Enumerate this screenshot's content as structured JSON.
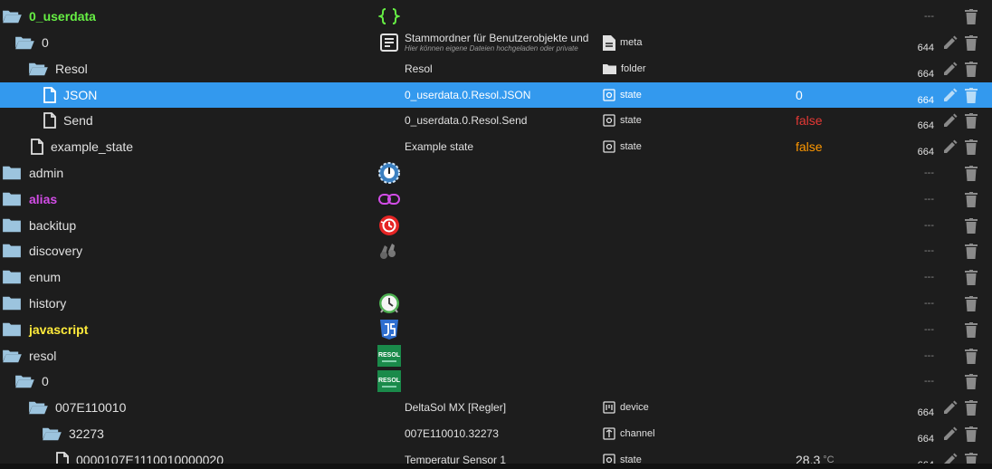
{
  "colors": {
    "accent_selected": "#3399ee",
    "folder_icon": "#9cc4de",
    "value_false_red": "#e53935",
    "value_false_orange": "#ff9800",
    "name_green": "#66ee44",
    "name_magenta": "#d24de6",
    "name_yellow": "#ffeb3b"
  },
  "rows": [
    {
      "name": "0_userdata",
      "icon": "curly-braces-icon",
      "description": "",
      "description_sub": "",
      "type": "",
      "type_icon": "",
      "value": "",
      "unit": "",
      "acl": "---",
      "edit": false
    },
    {
      "name": "0",
      "icon": "note-document-icon",
      "description": "Stammordner für Benutzerobjekte und",
      "description_sub": "Hier können eigene Dateien hochgeladen oder private",
      "type": "meta",
      "type_icon": "meta-file-icon",
      "value": "",
      "unit": "",
      "acl": "644",
      "edit": true
    },
    {
      "name": "Resol",
      "icon": "",
      "description": "Resol",
      "description_sub": "",
      "type": "folder",
      "type_icon": "folder-type-icon",
      "value": "",
      "unit": "",
      "acl": "664",
      "edit": true
    },
    {
      "name": "JSON",
      "icon": "",
      "description": "0_userdata.0.Resol.JSON",
      "description_sub": "",
      "type": "state",
      "type_icon": "state-type-icon",
      "value": "0",
      "unit": "",
      "acl": "664",
      "edit": true
    },
    {
      "name": "Send",
      "icon": "",
      "description": "0_userdata.0.Resol.Send",
      "description_sub": "",
      "type": "state",
      "type_icon": "state-type-icon",
      "value": "false",
      "unit": "",
      "acl": "664",
      "edit": true
    },
    {
      "name": "example_state",
      "icon": "",
      "description": "Example state",
      "description_sub": "",
      "type": "state",
      "type_icon": "state-type-icon",
      "value": "false",
      "unit": "",
      "acl": "664",
      "edit": true
    },
    {
      "name": "admin",
      "icon": "admin-gear-icon",
      "description": "",
      "description_sub": "",
      "type": "",
      "type_icon": "",
      "value": "",
      "unit": "",
      "acl": "---",
      "edit": false
    },
    {
      "name": "alias",
      "icon": "link-icon",
      "description": "",
      "description_sub": "",
      "type": "",
      "type_icon": "",
      "value": "",
      "unit": "",
      "acl": "---",
      "edit": false
    },
    {
      "name": "backitup",
      "icon": "backup-restore-icon",
      "description": "",
      "description_sub": "",
      "type": "",
      "type_icon": "",
      "value": "",
      "unit": "",
      "acl": "---",
      "edit": false
    },
    {
      "name": "discovery",
      "icon": "binoculars-icon",
      "description": "",
      "description_sub": "",
      "type": "",
      "type_icon": "",
      "value": "",
      "unit": "",
      "acl": "---",
      "edit": false
    },
    {
      "name": "enum",
      "icon": "",
      "description": "",
      "description_sub": "",
      "type": "",
      "type_icon": "",
      "value": "",
      "unit": "",
      "acl": "---",
      "edit": false
    },
    {
      "name": "history",
      "icon": "clock-icon",
      "description": "",
      "description_sub": "",
      "type": "",
      "type_icon": "",
      "value": "",
      "unit": "",
      "acl": "---",
      "edit": false
    },
    {
      "name": "javascript",
      "icon": "javascript-logo-icon",
      "description": "",
      "description_sub": "",
      "type": "",
      "type_icon": "",
      "value": "",
      "unit": "",
      "acl": "---",
      "edit": false
    },
    {
      "name": "resol",
      "icon": "resol-logo-icon",
      "description": "",
      "description_sub": "",
      "type": "",
      "type_icon": "",
      "value": "",
      "unit": "",
      "acl": "---",
      "edit": false
    },
    {
      "name": "0",
      "icon": "resol-logo-icon",
      "description": "",
      "description_sub": "",
      "type": "",
      "type_icon": "",
      "value": "",
      "unit": "",
      "acl": "---",
      "edit": false
    },
    {
      "name": "007E110010",
      "icon": "",
      "description": "DeltaSol MX [Regler]",
      "description_sub": "",
      "type": "device",
      "type_icon": "device-type-icon",
      "value": "",
      "unit": "",
      "acl": "664",
      "edit": true
    },
    {
      "name": "32273",
      "icon": "",
      "description": "007E110010.32273",
      "description_sub": "",
      "type": "channel",
      "type_icon": "channel-type-icon",
      "value": "",
      "unit": "",
      "acl": "664",
      "edit": true
    },
    {
      "name": "0000107E1110010000020",
      "icon": "",
      "description": "Temperatur Sensor 1",
      "description_sub": "",
      "type": "state",
      "type_icon": "state-type-icon",
      "value": "28.3",
      "unit": "°C",
      "acl": "664",
      "edit": true
    }
  ],
  "resol_logo_text": "RESOL"
}
